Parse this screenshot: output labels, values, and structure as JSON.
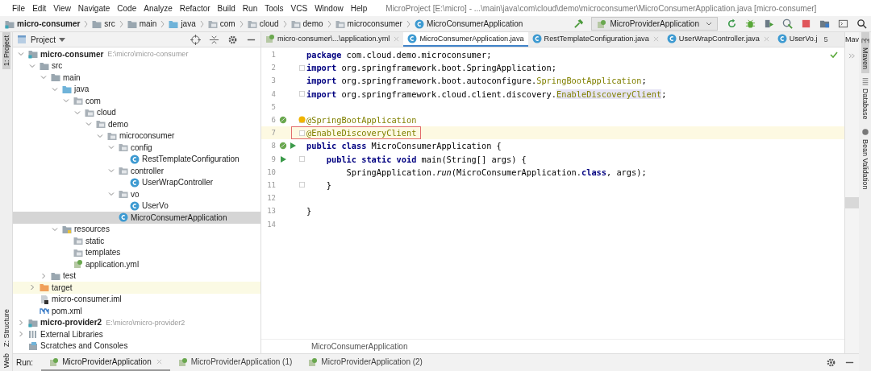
{
  "menu": [
    "File",
    "Edit",
    "View",
    "Navigate",
    "Code",
    "Analyze",
    "Refactor",
    "Build",
    "Run",
    "Tools",
    "VCS",
    "Window",
    "Help"
  ],
  "window": {
    "title": "MicroProject [E:\\micro] - ...\\main\\java\\com\\cloud\\demo\\microconsumer\\MicroConsumerApplication.java [micro-consumer]"
  },
  "breadcrumbs": [
    {
      "label": "micro-consumer",
      "kind": "module"
    },
    {
      "label": "src",
      "kind": "folder"
    },
    {
      "label": "main",
      "kind": "folder"
    },
    {
      "label": "java",
      "kind": "source"
    },
    {
      "label": "com",
      "kind": "package"
    },
    {
      "label": "cloud",
      "kind": "package"
    },
    {
      "label": "demo",
      "kind": "package"
    },
    {
      "label": "microconsumer",
      "kind": "package"
    },
    {
      "label": "MicroConsumerApplication",
      "kind": "class"
    }
  ],
  "run_config": {
    "label": "MicroProviderApplication"
  },
  "left_stripe": {
    "top": [
      {
        "label": "1: Project",
        "selected": true
      }
    ],
    "bottom": [
      {
        "label": "Z: Structure",
        "selected": false
      },
      {
        "label": "Web",
        "selected": false
      }
    ]
  },
  "project_panel": {
    "title": "Project",
    "tree": [
      {
        "label": "micro-consumer",
        "kind": "module",
        "bold": true,
        "path": "E:\\micro\\micro-consumer",
        "expanded": true,
        "children": [
          {
            "label": "src",
            "kind": "folder",
            "expanded": true,
            "children": [
              {
                "label": "main",
                "kind": "folder",
                "expanded": true,
                "children": [
                  {
                    "label": "java",
                    "kind": "source",
                    "expanded": true,
                    "children": [
                      {
                        "label": "com",
                        "kind": "package",
                        "expanded": true,
                        "children": [
                          {
                            "label": "cloud",
                            "kind": "package",
                            "expanded": true,
                            "children": [
                              {
                                "label": "demo",
                                "kind": "package",
                                "expanded": true,
                                "children": [
                                  {
                                    "label": "microconsumer",
                                    "kind": "package",
                                    "expanded": true,
                                    "children": [
                                      {
                                        "label": "config",
                                        "kind": "package",
                                        "expanded": true,
                                        "children": [
                                          {
                                            "label": "RestTemplateConfiguration",
                                            "kind": "class"
                                          }
                                        ]
                                      },
                                      {
                                        "label": "controller",
                                        "kind": "package",
                                        "expanded": true,
                                        "children": [
                                          {
                                            "label": "UserWrapController",
                                            "kind": "class"
                                          }
                                        ]
                                      },
                                      {
                                        "label": "vo",
                                        "kind": "package",
                                        "expanded": true,
                                        "children": [
                                          {
                                            "label": "UserVo",
                                            "kind": "class"
                                          }
                                        ]
                                      },
                                      {
                                        "label": "MicroConsumerApplication",
                                        "kind": "class",
                                        "selected": true
                                      }
                                    ]
                                  }
                                ]
                              }
                            ]
                          }
                        ]
                      }
                    ]
                  },
                  {
                    "label": "resources",
                    "kind": "resources",
                    "expanded": true,
                    "children": [
                      {
                        "label": "static",
                        "kind": "package"
                      },
                      {
                        "label": "templates",
                        "kind": "package"
                      },
                      {
                        "label": "application.yml",
                        "kind": "yml"
                      }
                    ]
                  }
                ]
              },
              {
                "label": "test",
                "kind": "folder",
                "expanded": false
              }
            ]
          },
          {
            "label": "target",
            "kind": "excluded",
            "expanded": false,
            "highlighted": true
          },
          {
            "label": "micro-consumer.iml",
            "kind": "iml"
          },
          {
            "label": "pom.xml",
            "kind": "maven"
          }
        ]
      },
      {
        "label": "micro-provider2",
        "kind": "module",
        "bold": true,
        "path": "E:\\micro\\micro-provider2",
        "expanded": false
      },
      {
        "label": "External Libraries",
        "kind": "libraries",
        "expanded": false
      },
      {
        "label": "Scratches and Consoles",
        "kind": "scratches"
      }
    ]
  },
  "editor_tabs": [
    {
      "label": "micro-consumer\\...\\application.yml",
      "kind": "yml",
      "selected": false,
      "closable": true
    },
    {
      "label": "MicroConsumerApplication.java",
      "kind": "class",
      "selected": true,
      "closable": false
    },
    {
      "label": "RestTemplateConfiguration.java",
      "kind": "class",
      "selected": false,
      "closable": true
    },
    {
      "label": "UserWrapController.java",
      "kind": "class",
      "selected": false,
      "closable": true
    },
    {
      "label": "UserVo.j",
      "kind": "class",
      "selected": false,
      "closable": false
    }
  ],
  "tabs_overflow": "5",
  "code": [
    {
      "number": "1",
      "tokens": [
        {
          "kind": "kw",
          "text": "package"
        },
        {
          "kind": "plain",
          "text": " com.cloud.demo.microconsumer;"
        }
      ]
    },
    {
      "number": "2",
      "fold": true,
      "tokens": [
        {
          "kind": "kw",
          "text": "import"
        },
        {
          "kind": "plain",
          "text": " org.springframework.boot.SpringApplication;"
        }
      ]
    },
    {
      "number": "3",
      "tokens": [
        {
          "kind": "kw",
          "text": "import"
        },
        {
          "kind": "plain",
          "text": " org.springframework.boot.autoconfigure."
        },
        {
          "kind": "ann",
          "text": "SpringBootApplication"
        },
        {
          "kind": "plain",
          "text": ";"
        }
      ]
    },
    {
      "number": "4",
      "fold": true,
      "tokens": [
        {
          "kind": "kw",
          "text": "import"
        },
        {
          "kind": "plain",
          "text": " org.springframework.cloud.client.discovery."
        },
        {
          "kind": "usage",
          "text": "EnableDiscoveryClient"
        },
        {
          "kind": "plain",
          "text": ";"
        }
      ]
    },
    {
      "number": "5"
    },
    {
      "number": "6",
      "fold": true,
      "gutter_icons": [
        {
          "kind": "bean"
        }
      ],
      "bulb": true,
      "tokens": [
        {
          "kind": "ann",
          "text": "@SpringBootApplication"
        }
      ]
    },
    {
      "number": "7",
      "fold": true,
      "current": true,
      "boxed": true,
      "tokens": [
        {
          "kind": "ann",
          "text": "@EnableDiscoveryClient"
        }
      ]
    },
    {
      "number": "8",
      "gutter_icons": [
        {
          "kind": "bean"
        },
        {
          "kind": "run"
        }
      ],
      "tokens": [
        {
          "kind": "kw",
          "text": "public class"
        },
        {
          "kind": "plain",
          "text": " MicroConsumerApplication {"
        }
      ]
    },
    {
      "number": "9",
      "fold": true,
      "gutter_icons": [
        {
          "kind": "run"
        }
      ],
      "tokens": [
        {
          "kind": "kw",
          "text": "    public static void"
        },
        {
          "kind": "plain",
          "text": " main(String[] args) {"
        }
      ]
    },
    {
      "number": "10",
      "tokens": [
        {
          "kind": "plain",
          "text": "        SpringApplication."
        },
        {
          "kind": "italic",
          "text": "run"
        },
        {
          "kind": "plain",
          "text": "(MicroConsumerApplication."
        },
        {
          "kind": "kw",
          "text": "class"
        },
        {
          "kind": "plain",
          "text": ", args);"
        }
      ]
    },
    {
      "number": "11",
      "fold": true,
      "tokens": [
        {
          "kind": "plain",
          "text": "    }"
        }
      ]
    },
    {
      "number": "12"
    },
    {
      "number": "13",
      "tokens": [
        {
          "kind": "plain",
          "text": "}"
        }
      ]
    },
    {
      "number": "14"
    }
  ],
  "editor_breadcrumb": "MicroConsumerApplication",
  "maven_panel": {
    "title": "Mav"
  },
  "right_stripe": [
    {
      "label": "Maven",
      "kind": "maven",
      "selected": true
    },
    {
      "label": "Database",
      "kind": "database",
      "selected": false
    },
    {
      "label": "Bean Validation",
      "kind": "bean",
      "selected": false
    }
  ],
  "run_bar": {
    "label": "Run:",
    "tabs": [
      {
        "label": "MicroProviderApplication",
        "selected": true,
        "closable": true
      },
      {
        "label": "MicroProviderApplication (1)",
        "selected": false,
        "closable": false
      },
      {
        "label": "MicroProviderApplication (2)",
        "selected": false,
        "closable": false
      }
    ]
  }
}
